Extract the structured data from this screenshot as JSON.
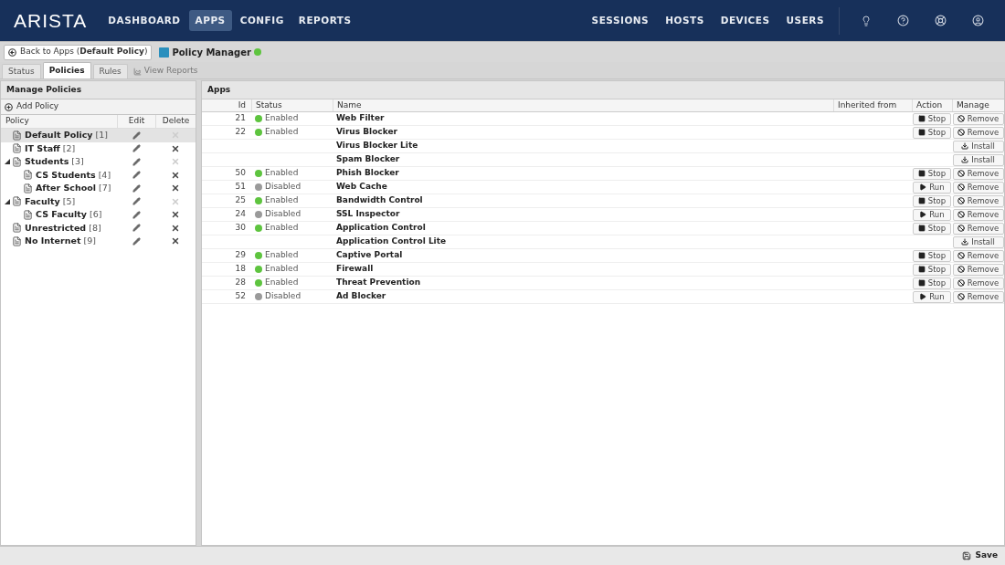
{
  "header": {
    "logo": "ARISTA",
    "nav_left": [
      {
        "label": "DASHBOARD",
        "selected": false
      },
      {
        "label": "APPS",
        "selected": true
      },
      {
        "label": "CONFIG",
        "selected": false
      },
      {
        "label": "REPORTS",
        "selected": false
      }
    ],
    "nav_right": [
      "SESSIONS",
      "HOSTS",
      "DEVICES",
      "USERS"
    ]
  },
  "toolbar": {
    "back_button": "Back to Apps (**Default Policy**)",
    "app_title": "Policy Manager",
    "app_running": true
  },
  "tabs": [
    {
      "label": "Status",
      "selected": false
    },
    {
      "label": "Policies",
      "selected": true
    },
    {
      "label": "Rules",
      "selected": false
    }
  ],
  "view_reports_link": "View Reports",
  "policies_panel": {
    "title": "Manage Policies",
    "add_button": "Add Policy",
    "columns": [
      "Policy",
      "Edit",
      "Delete"
    ],
    "items": [
      {
        "name": "Default Policy",
        "number": "[1]",
        "selected": true,
        "deletable": false
      },
      {
        "name": "IT Staff",
        "number": "[2]",
        "selected": false,
        "deletable": true
      },
      {
        "name": "Students",
        "number": "[3]",
        "selected": false,
        "deletable": false,
        "expanded": true,
        "children": [
          {
            "name": "CS Students",
            "number": "[4]",
            "selected": false,
            "deletable": true
          },
          {
            "name": "After School",
            "number": "[7]",
            "selected": false,
            "deletable": true
          }
        ]
      },
      {
        "name": "Faculty",
        "number": "[5]",
        "selected": false,
        "deletable": false,
        "expanded": true,
        "children": [
          {
            "name": "CS Faculty",
            "number": "[6]",
            "selected": false,
            "deletable": true
          }
        ]
      },
      {
        "name": "Unrestricted",
        "number": "[8]",
        "selected": false,
        "deletable": true
      },
      {
        "name": "No Internet",
        "number": "[9]",
        "selected": false,
        "deletable": true
      }
    ]
  },
  "apps_panel": {
    "title": "Apps",
    "columns": [
      "Id",
      "Status",
      "Name",
      "Inherited from",
      "Action",
      "Manage"
    ],
    "rows": [
      {
        "id": "21",
        "status": {
          "label": "Enabled",
          "enabled": true
        },
        "name": "Web Filter",
        "action": {
          "label": "Stop",
          "kind": "stop"
        },
        "manage": {
          "label": "Remove",
          "kind": "remove"
        }
      },
      {
        "id": "22",
        "status": {
          "label": "Enabled",
          "enabled": true
        },
        "name": "Virus Blocker",
        "action": {
          "label": "Stop",
          "kind": "stop"
        },
        "manage": {
          "label": "Remove",
          "kind": "remove"
        }
      },
      {
        "name": "Virus Blocker Lite",
        "manage": {
          "label": "Install",
          "kind": "install"
        }
      },
      {
        "name": "Spam Blocker",
        "manage": {
          "label": "Install",
          "kind": "install"
        }
      },
      {
        "id": "50",
        "status": {
          "label": "Enabled",
          "enabled": true
        },
        "name": "Phish Blocker",
        "action": {
          "label": "Stop",
          "kind": "stop"
        },
        "manage": {
          "label": "Remove",
          "kind": "remove"
        }
      },
      {
        "id": "51",
        "status": {
          "label": "Disabled",
          "enabled": false
        },
        "name": "Web Cache",
        "action": {
          "label": "Run",
          "kind": "run"
        },
        "manage": {
          "label": "Remove",
          "kind": "remove"
        }
      },
      {
        "id": "25",
        "status": {
          "label": "Enabled",
          "enabled": true
        },
        "name": "Bandwidth Control",
        "action": {
          "label": "Stop",
          "kind": "stop"
        },
        "manage": {
          "label": "Remove",
          "kind": "remove"
        }
      },
      {
        "id": "24",
        "status": {
          "label": "Disabled",
          "enabled": false
        },
        "name": "SSL Inspector",
        "action": {
          "label": "Run",
          "kind": "run"
        },
        "manage": {
          "label": "Remove",
          "kind": "remove"
        }
      },
      {
        "id": "30",
        "status": {
          "label": "Enabled",
          "enabled": true
        },
        "name": "Application Control",
        "action": {
          "label": "Stop",
          "kind": "stop"
        },
        "manage": {
          "label": "Remove",
          "kind": "remove"
        }
      },
      {
        "name": "Application Control Lite",
        "manage": {
          "label": "Install",
          "kind": "install"
        }
      },
      {
        "id": "29",
        "status": {
          "label": "Enabled",
          "enabled": true
        },
        "name": "Captive Portal",
        "action": {
          "label": "Stop",
          "kind": "stop"
        },
        "manage": {
          "label": "Remove",
          "kind": "remove"
        }
      },
      {
        "id": "18",
        "status": {
          "label": "Enabled",
          "enabled": true
        },
        "name": "Firewall",
        "action": {
          "label": "Stop",
          "kind": "stop"
        },
        "manage": {
          "label": "Remove",
          "kind": "remove"
        }
      },
      {
        "id": "28",
        "status": {
          "label": "Enabled",
          "enabled": true
        },
        "name": "Threat Prevention",
        "action": {
          "label": "Stop",
          "kind": "stop"
        },
        "manage": {
          "label": "Remove",
          "kind": "remove"
        }
      },
      {
        "id": "52",
        "status": {
          "label": "Disabled",
          "enabled": false
        },
        "name": "Ad Blocker",
        "action": {
          "label": "Run",
          "kind": "run"
        },
        "manage": {
          "label": "Remove",
          "kind": "remove"
        }
      }
    ]
  },
  "footer": {
    "save_button": "Save"
  }
}
